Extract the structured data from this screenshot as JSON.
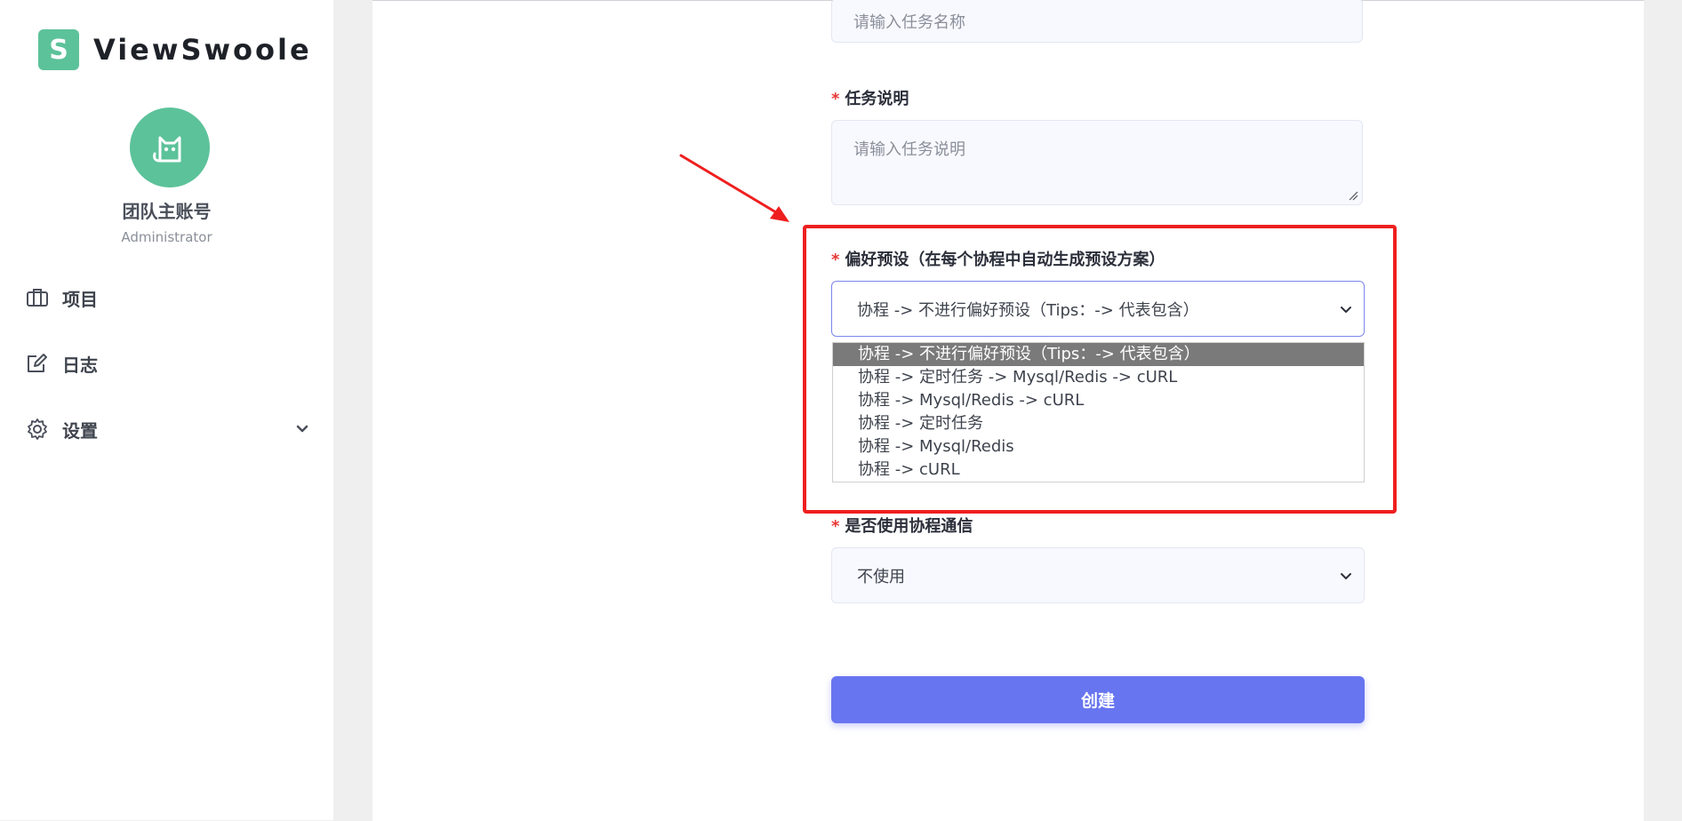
{
  "brand": {
    "logo_letter": "S",
    "name": "ViewSwoole",
    "color": "#5cc29a"
  },
  "user": {
    "name": "团队主账号",
    "role": "Administrator"
  },
  "sidebar": {
    "items": [
      {
        "label": "项目",
        "icon": "briefcase-icon"
      },
      {
        "label": "日志",
        "icon": "edit-icon"
      },
      {
        "label": "设置",
        "icon": "gear-icon",
        "expandable": true
      }
    ]
  },
  "form": {
    "task_name": {
      "placeholder": "请输入任务名称"
    },
    "task_desc": {
      "label": "任务说明",
      "required_mark": "*",
      "placeholder": "请输入任务说明"
    },
    "preference": {
      "label": "偏好预设（在每个协程中自动生成预设方案）",
      "required_mark": "*",
      "selected": "协程 -> 不进行偏好预设（Tips：-> 代表包含）",
      "options": [
        "协程 -> 不进行偏好预设（Tips：-> 代表包含）",
        "协程 -> 定时任务 -> Mysql/Redis -> cURL",
        "协程 -> Mysql/Redis -> cURL",
        "协程 -> 定时任务",
        "协程 -> Mysql/Redis",
        "协程 -> cURL"
      ]
    },
    "coroutine_comm": {
      "label": "是否使用协程通信",
      "required_mark": "*",
      "selected": "不使用"
    },
    "submit_label": "创建"
  },
  "colors": {
    "accent": "#6875f0",
    "highlight": "#ef1f1f",
    "required": "#e53935"
  }
}
